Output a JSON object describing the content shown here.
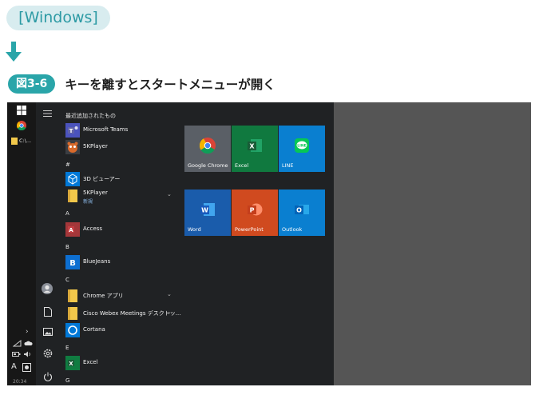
{
  "header": {
    "platform_label": "[Windows]",
    "figure_badge": "図3-6",
    "figure_title": "キーを離すとスタートメニューが開く"
  },
  "taskbar": {
    "pinned_label": "C:\\...",
    "clock": "20:34"
  },
  "start_menu": {
    "recent_header": "最近追加されたもの",
    "groups": {
      "hash": "#",
      "a": "A",
      "b": "B",
      "c": "C",
      "e": "E",
      "g": "G"
    },
    "apps": {
      "teams": "Microsoft Teams",
      "fiveplayer": "5KPlayer",
      "viewer3d": "3D ビューアー",
      "fiveplayer_folder": "5KPlayer",
      "fiveplayer_new": "新規",
      "access": "Access",
      "bluejeans": "BlueJeans",
      "chrome_apps": "Chrome アプリ",
      "webex": "Cisco Webex Meetings デスクトッ...",
      "cortana": "Cortana",
      "excel": "Excel"
    },
    "tiles": {
      "chrome": "Google Chrome",
      "excel": "Excel",
      "line": "LINE",
      "word": "Word",
      "powerpoint": "PowerPoint",
      "outlook": "Outlook"
    }
  },
  "colors": {
    "accent": "#2aa5a9",
    "menu_bg": "#202224",
    "desktop_bg": "#555555"
  }
}
